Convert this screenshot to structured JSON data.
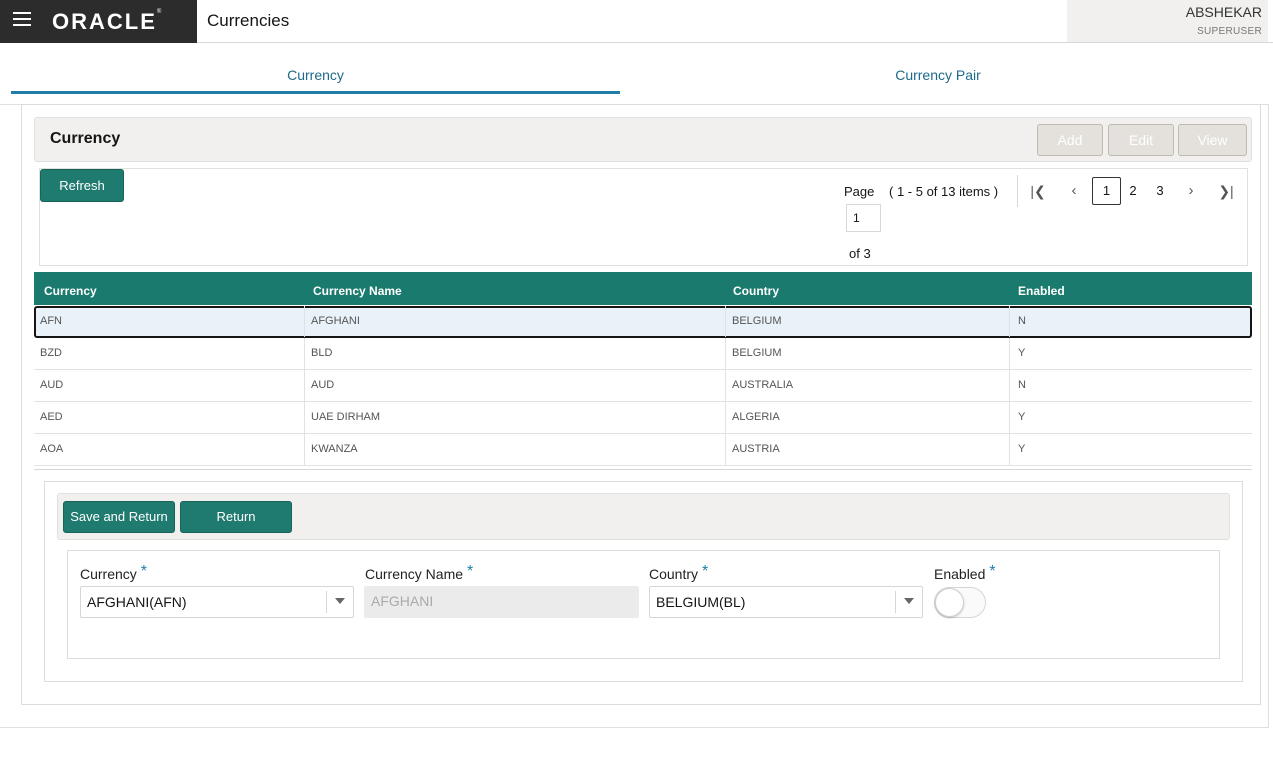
{
  "header": {
    "logo_text": "ORACLE",
    "logo_mark": "®",
    "title": "Currencies",
    "user_name": "ABSHEKAR",
    "user_role": "SUPERUSER"
  },
  "tabs": [
    {
      "label": "Currency",
      "active": true
    },
    {
      "label": "Currency Pair",
      "active": false
    }
  ],
  "section": {
    "title": "Currency",
    "actions": {
      "add": "Add",
      "edit": "Edit",
      "view": "View"
    }
  },
  "toolbar": {
    "refresh_label": "Refresh",
    "page_label": "Page",
    "items_info": "( 1 - 5 of 13 items )",
    "page_value": "1",
    "of_label": "of 3",
    "pages": [
      "1",
      "2",
      "3"
    ],
    "current_page": "1"
  },
  "table": {
    "columns": [
      "Currency",
      "Currency Name",
      "Country",
      "Enabled"
    ],
    "rows": [
      [
        "AFN",
        "AFGHANI",
        "BELGIUM",
        "N"
      ],
      [
        "BZD",
        "BLD",
        "BELGIUM",
        "Y"
      ],
      [
        "AUD",
        "AUD",
        "AUSTRALIA",
        "N"
      ],
      [
        "AED",
        "UAE DIRHAM",
        "ALGERIA",
        "Y"
      ],
      [
        "AOA",
        "KWANZA",
        "AUSTRIA",
        "Y"
      ]
    ],
    "selected_row": 0
  },
  "form": {
    "save_label": "Save and Return",
    "return_label": "Return",
    "required_mark": "*",
    "fields": {
      "currency": {
        "label": "Currency",
        "value": "AFGHANI(AFN)"
      },
      "currency_name": {
        "label": "Currency Name",
        "value": "AFGHANI"
      },
      "country": {
        "label": "Country",
        "value": "BELGIUM(BL)"
      },
      "enabled": {
        "label": "Enabled",
        "value": false
      }
    }
  },
  "colors": {
    "accent_teal": "#1f7a70",
    "header_dark": "#2c2c2c",
    "tab_blue": "#1e7ea8"
  }
}
